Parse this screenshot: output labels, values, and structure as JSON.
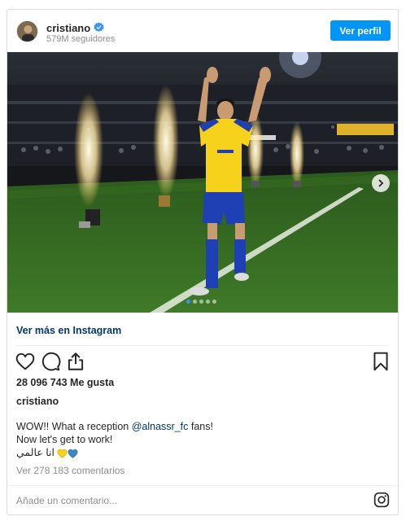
{
  "header": {
    "username": "cristiano",
    "followers": "579M seguidores",
    "follow_button": "Ver perfil"
  },
  "photo": {
    "carousel_total": 5,
    "carousel_index": 1
  },
  "links": {
    "view_more": "Ver más en Instagram"
  },
  "stats": {
    "likes": "28 096 743 Me gusta"
  },
  "caption": {
    "username": "cristiano",
    "line1_before": "WOW!! What a reception ",
    "mention": "@alnassr_fc",
    "line1_after": " fans!",
    "line2": "Now let's get to work!",
    "line3": "انا عالمي"
  },
  "comments": {
    "view_all": "Ver 278 183 comentarios",
    "add_placeholder": "Añade un comentario..."
  },
  "colors": {
    "accent": "#0095f6",
    "link": "#00376b",
    "muted": "#8e8e8e",
    "verified": "#3897f0",
    "jersey_yellow": "#f6d21c",
    "jersey_blue": "#1f3fb5"
  },
  "icons": [
    "verified-badge-icon",
    "heart-icon",
    "comment-icon",
    "share-icon",
    "bookmark-icon",
    "chevron-right-icon",
    "instagram-icon",
    "yellow-heart-icon",
    "blue-heart-icon"
  ]
}
